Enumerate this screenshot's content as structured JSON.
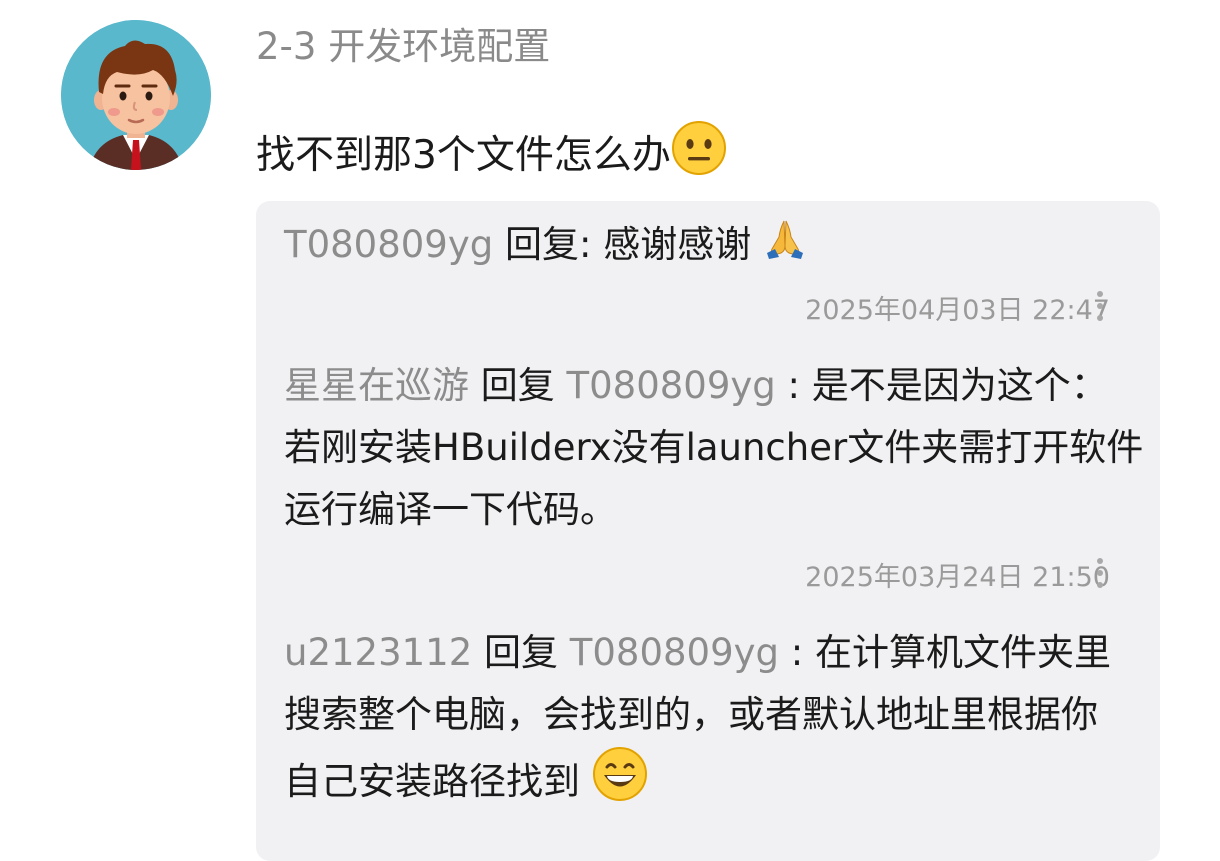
{
  "header": {
    "course_title": "2-3 开发环境配置"
  },
  "question": {
    "text": "找不到那3个文件怎么办",
    "emoji": "neutral-face-emoji"
  },
  "replies": [
    {
      "user": "T080809yg",
      "action": "回复",
      "target": "",
      "content": ": 感谢感谢",
      "emoji": "folded-hands-emoji",
      "timestamp": "2025年04月03日 22:47"
    },
    {
      "user": "星星在巡游",
      "action": "回复",
      "target": "T080809yg",
      "content": "是不是因为这个：若刚安装HBuilderx没有launcher文件夹需打开软件运行编译一下代码。",
      "timestamp": "2025年03月24日 21:50"
    },
    {
      "user": "u2123112",
      "action": "回复",
      "target": "T080809yg",
      "content": "在计算机文件夹里搜索整个电脑，会找到的，或者默认地址里根据你自己安装路径找到",
      "emoji": "grinning-face-emoji"
    }
  ],
  "colors": {
    "panel_bg": "#f1f1f3",
    "username": "#8c8c8c",
    "meta": "#9a9a9a",
    "avatar_bg": "#5ab8cc"
  }
}
